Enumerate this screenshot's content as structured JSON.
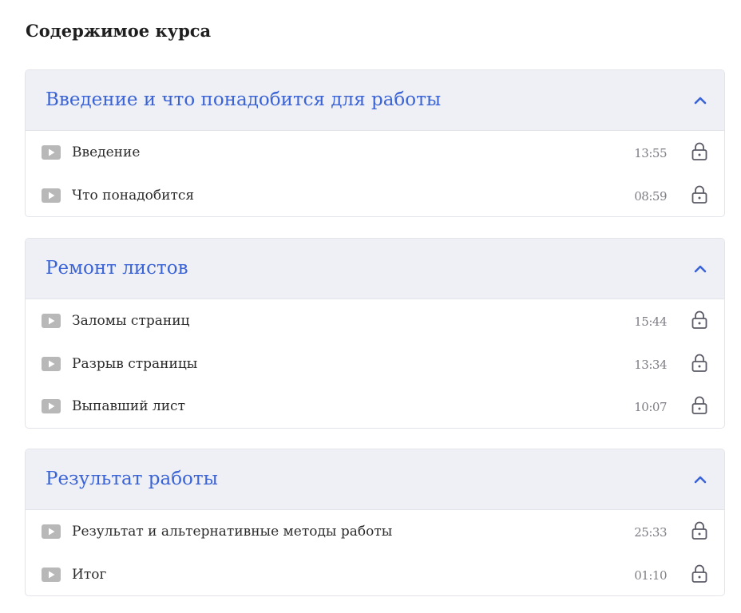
{
  "page": {
    "title": "Содержимое курса"
  },
  "colors": {
    "accent": "#3a63d6",
    "header_bg": "#eff0f5",
    "border": "#e3e4ea",
    "play_icon": "#b8b8b8",
    "lock_icon": "#5a5a66"
  },
  "icons": {
    "lesson": "play-icon",
    "locked": "lock-icon",
    "collapse": "chevron-up-icon"
  },
  "sections": [
    {
      "title": "Введение и что понадобится для работы",
      "expanded": true,
      "lessons": [
        {
          "title": "Введение",
          "duration": "13:55",
          "locked": true
        },
        {
          "title": "Что понадобится",
          "duration": "08:59",
          "locked": true
        }
      ]
    },
    {
      "title": "Ремонт листов",
      "expanded": true,
      "lessons": [
        {
          "title": "Заломы страниц",
          "duration": "15:44",
          "locked": true
        },
        {
          "title": "Разрыв страницы",
          "duration": "13:34",
          "locked": true
        },
        {
          "title": "Выпавший лист",
          "duration": "10:07",
          "locked": true
        }
      ]
    },
    {
      "title": "Результат работы",
      "expanded": true,
      "lessons": [
        {
          "title": "Результат и альтернативные методы работы",
          "duration": "25:33",
          "locked": true
        },
        {
          "title": "Итог",
          "duration": "01:10",
          "locked": true
        }
      ]
    }
  ]
}
